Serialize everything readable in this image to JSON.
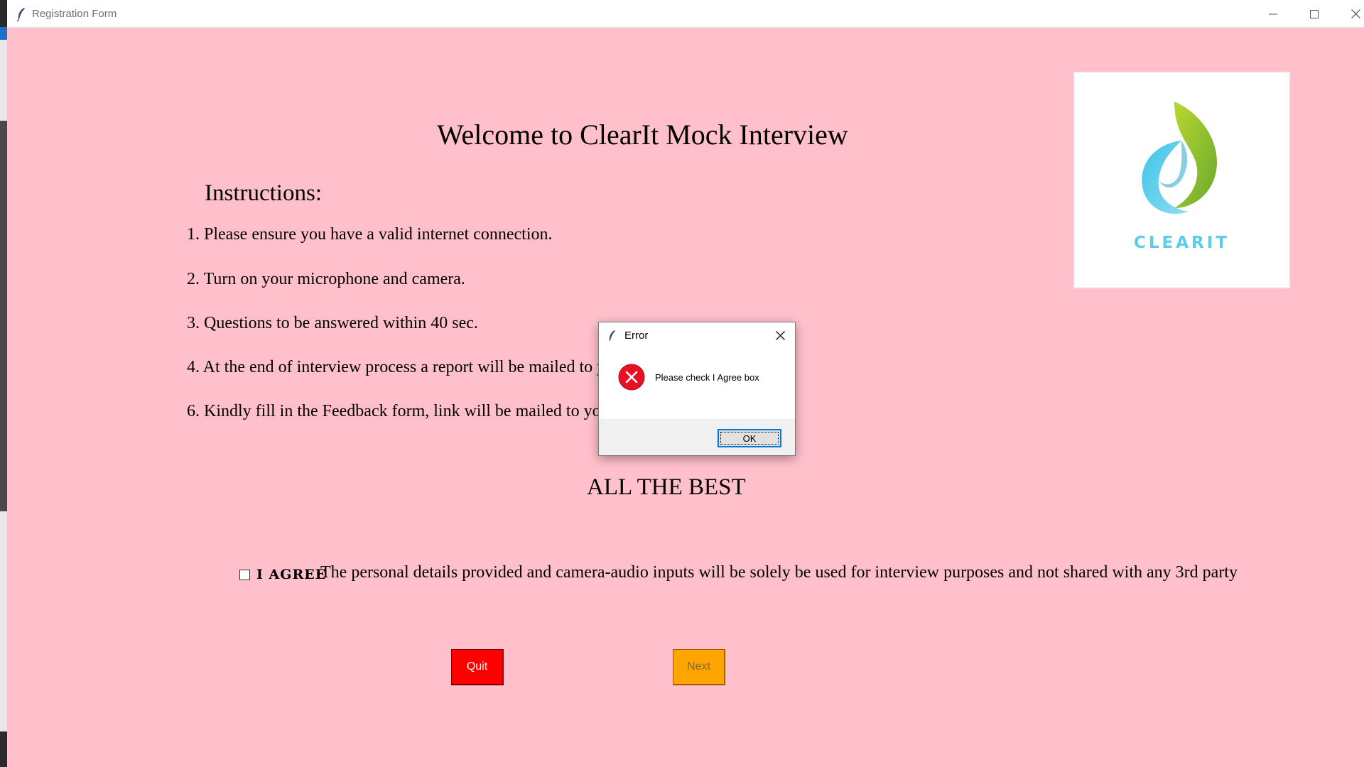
{
  "window": {
    "title": "Registration Form",
    "icons": {
      "app": "feather-icon",
      "minimize": "minimize-icon",
      "maximize": "maximize-icon",
      "close": "close-icon"
    }
  },
  "page": {
    "welcome_title": "Welcome to ClearIt Mock Interview",
    "instructions_heading": "Instructions:",
    "instructions": [
      "1. Please ensure you have a valid internet connection.",
      "2. Turn on your microphone and camera.",
      "3. Questions to be answered within 40 sec.",
      "4. At the end of interview process a report will be mailed to your registered email ID.",
      "6. Kindly fill in the Feedback form, link will be mailed to you."
    ],
    "closing": "ALL THE BEST",
    "logo_text": "CLEARIT",
    "agree_label": "I AGREE",
    "agree_checked": false,
    "consent_text": "The personal details provided and camera-audio inputs will be solely be used for interview purposes and not shared with any 3rd party",
    "quit_label": "Quit",
    "next_label": "Next"
  },
  "dialog": {
    "title": "Error",
    "message": "Please check I Agree box",
    "ok_label": "OK",
    "icon": "error-icon"
  },
  "colors": {
    "background": "#ffc0cb",
    "quit_button": "#ff0000",
    "next_button": "#ffa500",
    "logo_cyan": "#5ccce8",
    "logo_green": "#8cc63f",
    "error_red": "#e81123"
  }
}
